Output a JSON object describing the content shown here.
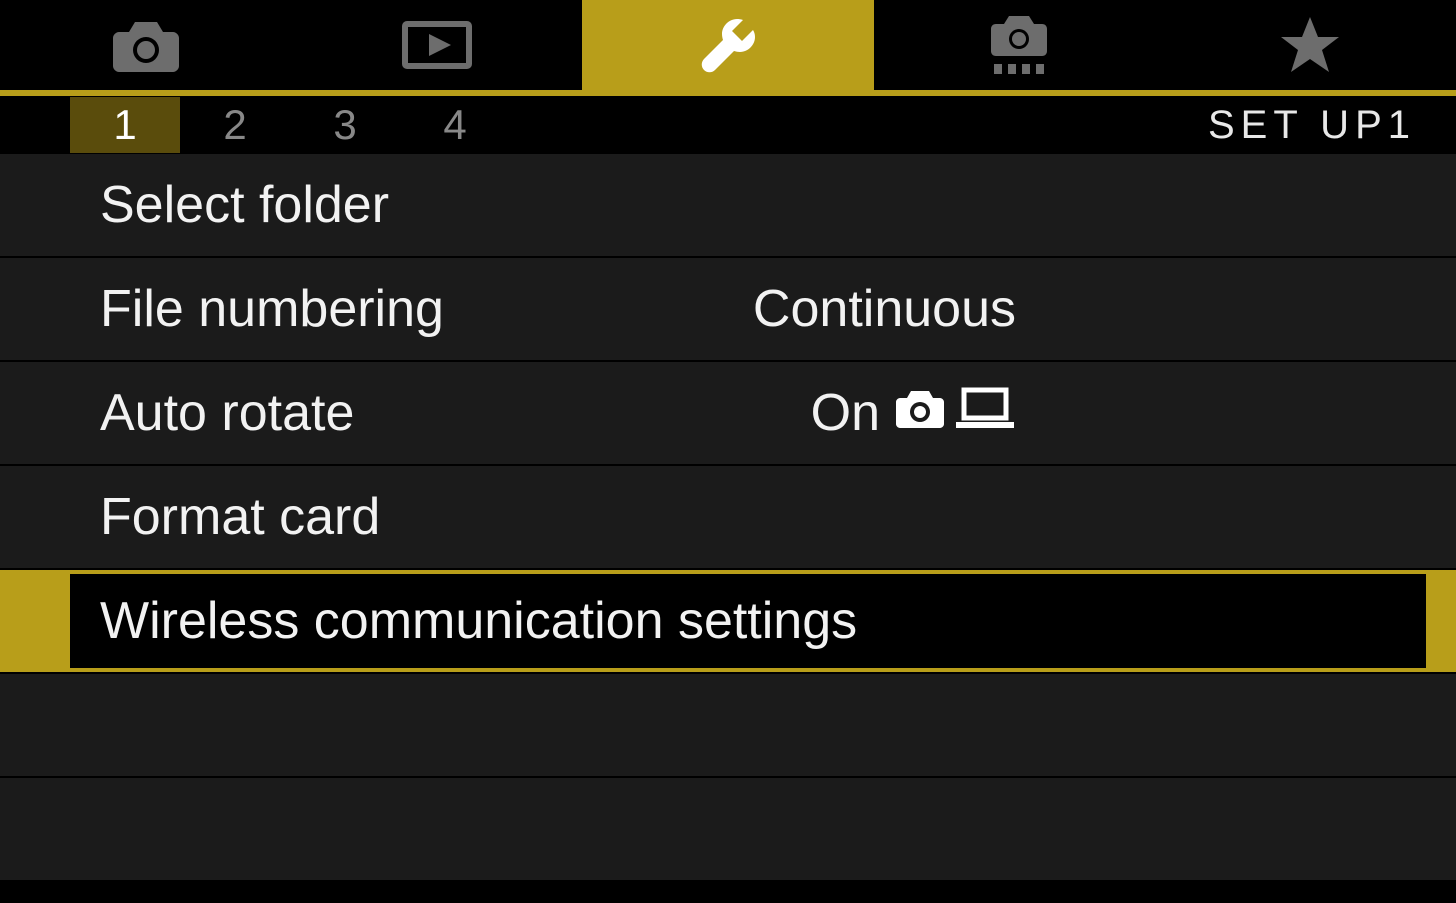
{
  "tabs": {
    "items": [
      "camera",
      "playback",
      "wrench",
      "custom",
      "star"
    ],
    "activeIndex": 2
  },
  "subtabs": {
    "pages": [
      "1",
      "2",
      "3",
      "4"
    ],
    "activeIndex": 0,
    "label": "SET UP1"
  },
  "menu": {
    "items": [
      {
        "label": "Select folder",
        "value": ""
      },
      {
        "label": "File numbering",
        "value": "Continuous"
      },
      {
        "label": "Auto rotate",
        "value": "On",
        "valueIcons": [
          "camera",
          "laptop"
        ]
      },
      {
        "label": "Format card",
        "value": ""
      },
      {
        "label": "Wireless communication settings",
        "value": "",
        "selected": true
      }
    ]
  },
  "colors": {
    "accent": "#b89e1a"
  }
}
